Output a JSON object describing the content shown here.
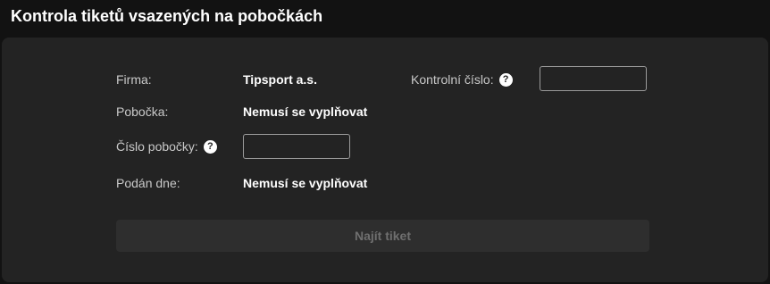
{
  "page": {
    "title": "Kontrola tiketů vsazených na pobočkách"
  },
  "form": {
    "firma": {
      "label": "Firma:",
      "value": "Tipsport a.s."
    },
    "kontrolni_cislo": {
      "label": "Kontrolní číslo:",
      "help_icon": "question-circle-icon",
      "value": "",
      "placeholder": ""
    },
    "pobocka": {
      "label": "Pobočka:",
      "value": "Nemusí se vyplňovat"
    },
    "cislo_pobocky": {
      "label": "Číslo pobočky:",
      "help_icon": "question-circle-icon",
      "value": "",
      "placeholder": ""
    },
    "podan_dne": {
      "label": "Podán dne:",
      "value": "Nemusí se vyplňovat"
    },
    "submit": {
      "label": "Najít tiket",
      "disabled": true
    }
  },
  "colors": {
    "background": "#121212",
    "panel": "#232323",
    "button_disabled_bg": "#2e2e2e",
    "button_disabled_text": "#6f6f6f"
  }
}
